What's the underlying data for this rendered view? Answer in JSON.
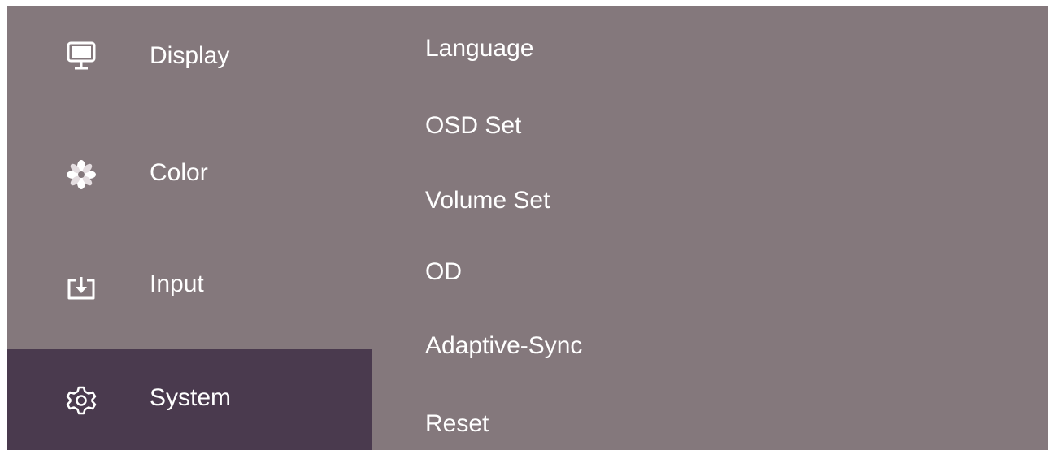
{
  "colors": {
    "panel_bg": "#84787c",
    "selected_bg": "#4a3a4e",
    "text": "#ffffff"
  },
  "main_menu": {
    "items": [
      {
        "label": "Display",
        "icon": "monitor-icon"
      },
      {
        "label": "Color",
        "icon": "color-flower-icon"
      },
      {
        "label": "Input",
        "icon": "input-source-icon"
      },
      {
        "label": "System",
        "icon": "gear-icon",
        "selected": true
      }
    ]
  },
  "submenu": {
    "items": [
      {
        "label": "Language"
      },
      {
        "label": "OSD Set"
      },
      {
        "label": "Volume Set"
      },
      {
        "label": "OD"
      },
      {
        "label": "Adaptive-Sync"
      },
      {
        "label": "Reset"
      }
    ]
  }
}
